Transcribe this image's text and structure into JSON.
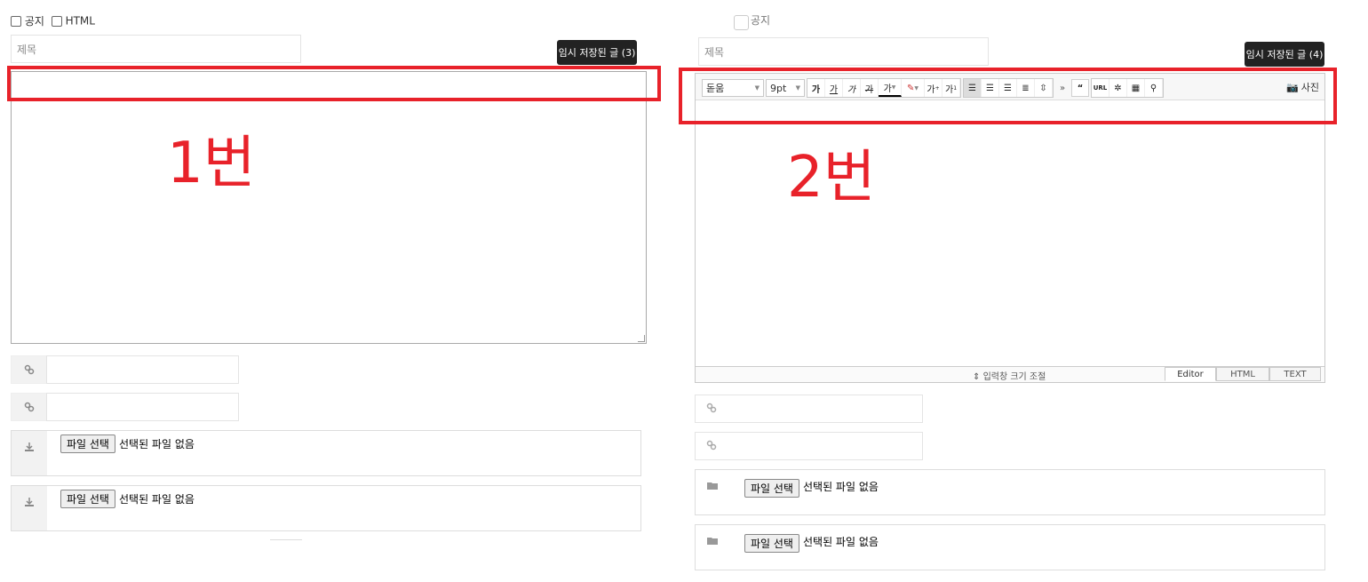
{
  "left": {
    "notice_label": "공지",
    "html_label": "HTML",
    "title_placeholder": "제목",
    "temp_saved_label": "임시 저장된 글 (3)",
    "annotation": "1번",
    "file_rows": [
      {
        "button": "파일 선택",
        "status": "선택된 파일 없음"
      },
      {
        "button": "파일 선택",
        "status": "선택된 파일 없음"
      }
    ]
  },
  "right": {
    "notice_label": "공지",
    "title_placeholder": "제목",
    "temp_saved_label": "임시 저장된 글 (4)",
    "annotation": "2번",
    "toolbar": {
      "font": "돋움",
      "size": "9pt",
      "bold": "가",
      "underline": "가",
      "italic": "가",
      "strike": "가",
      "text_color": "가",
      "superscript": "가",
      "subscript": "가",
      "url": "URL",
      "photo_label": "사진"
    },
    "resize_label": "입력창 크기 조절",
    "tabs": [
      "Editor",
      "HTML",
      "TEXT"
    ],
    "file_rows": [
      {
        "button": "파일 선택",
        "status": "선택된 파일 없음"
      },
      {
        "button": "파일 선택",
        "status": "선택된 파일 없음"
      }
    ]
  },
  "colors": {
    "annotation_red": "#e8222a",
    "dark_button": "#222222"
  }
}
